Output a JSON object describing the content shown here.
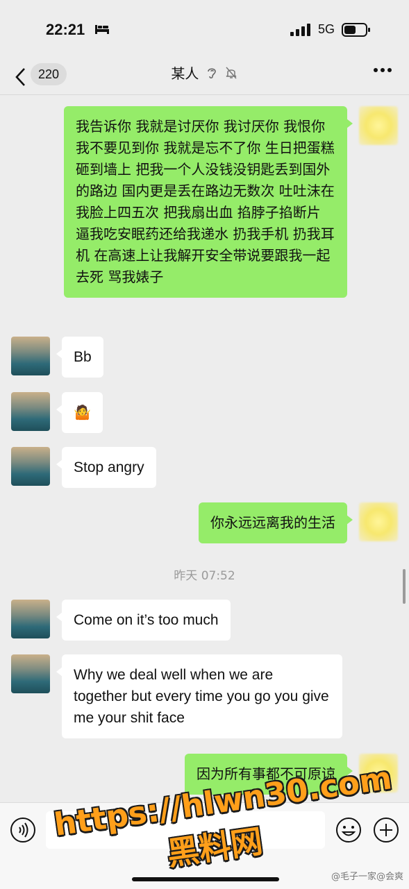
{
  "status": {
    "time": "22:21",
    "network": "5G"
  },
  "header": {
    "back_count": "220",
    "title": "某人"
  },
  "messages": [
    {
      "from": "me",
      "text": "我告诉你 我就是讨厌你 我讨厌你 我恨你 我不要见到你  我就是忘不了你 生日把蛋糕砸到墙上 把我一个人没钱没钥匙丢到国外的路边 国内更是丢在路边无数次 吐吐沫在我脸上四五次 把我扇出血 掐脖子掐断片 逼我吃安眠药还给我递水 扔我手机 扔我耳机 在高速上让我解开安全带说要跟我一起去死 骂我婊子"
    },
    {
      "from": "other",
      "text": "Bb"
    },
    {
      "from": "other",
      "text": "🤷"
    },
    {
      "from": "other",
      "text": "Stop angry"
    },
    {
      "from": "me",
      "text": "你永远远离我的生活"
    },
    {
      "from": "other",
      "text": "Come on it’s too much"
    },
    {
      "from": "other",
      "text": "Why we deal well when we are together but every time you go you give me your shit face"
    },
    {
      "from": "me",
      "text": "因为所有事都不可原谅"
    }
  ],
  "timestamp": "昨天 07:52",
  "watermark": {
    "line1": "https://hlwn30.com",
    "line2": "黑料网"
  },
  "credit": "@毛子一家@会爽"
}
